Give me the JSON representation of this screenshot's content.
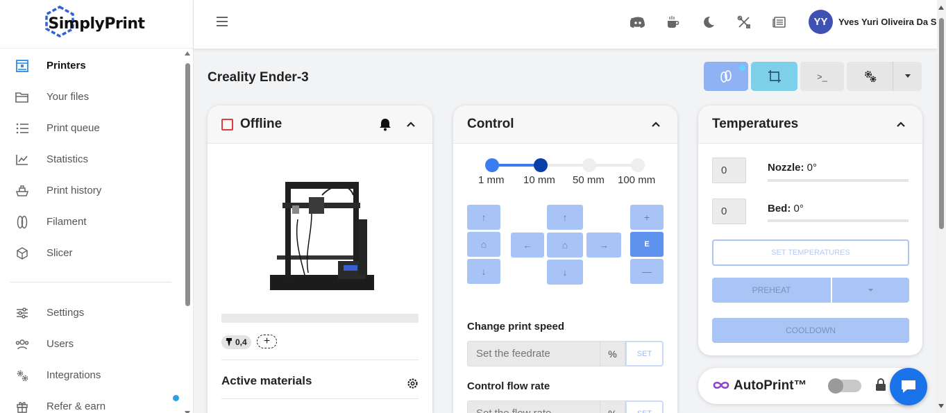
{
  "brand": {
    "logo_text": "SimplyPrint"
  },
  "sidebar": {
    "items": [
      {
        "label": "Printers",
        "icon": "printer-icon",
        "active": true
      },
      {
        "label": "Your files",
        "icon": "folder-icon"
      },
      {
        "label": "Print queue",
        "icon": "list-icon"
      },
      {
        "label": "Statistics",
        "icon": "chart-line-icon"
      },
      {
        "label": "Print history",
        "icon": "history-icon"
      },
      {
        "label": "Filament",
        "icon": "filament-spool-icon"
      },
      {
        "label": "Slicer",
        "icon": "cube-icon"
      }
    ],
    "items_bottom": [
      {
        "label": "Settings",
        "icon": "sliders-icon"
      },
      {
        "label": "Users",
        "icon": "users-icon"
      },
      {
        "label": "Integrations",
        "icon": "gears-icon"
      },
      {
        "label": "Refer & earn",
        "icon": "gift-icon"
      }
    ]
  },
  "topbar": {
    "icons": [
      "discord-icon",
      "coffee-icon",
      "moon-icon",
      "tools-icon",
      "news-icon"
    ],
    "avatar_initials": "YY",
    "username": "Yves Yuri Oliveira Da S"
  },
  "printer": {
    "name": "Creality Ender-3",
    "header_buttons": {
      "terminal_label": ">_"
    }
  },
  "status_card": {
    "title": "Offline",
    "nozzle_size": "0,4",
    "add_label": "+",
    "active_materials_title": "Active materials"
  },
  "control_card": {
    "title": "Control",
    "steps": [
      "1 mm",
      "10 mm",
      "50 mm",
      "100 mm"
    ],
    "selected_step": "10 mm",
    "jog": {
      "plus": "+",
      "minus": "—",
      "extruder": "E",
      "up": "↑",
      "down": "↓",
      "left": "←",
      "right": "→",
      "home": "⌂"
    },
    "print_speed": {
      "title": "Change print speed",
      "placeholder": "Set the feedrate",
      "unit": "%",
      "button": "SET"
    },
    "flow_rate": {
      "title": "Control flow rate",
      "placeholder": "Set the flow rate",
      "unit": "%",
      "button": "SET"
    }
  },
  "temperature_card": {
    "title": "Temperatures",
    "nozzle": {
      "input": "0",
      "label": "Nozzle:",
      "value": "0°"
    },
    "bed": {
      "input": "0",
      "label": "Bed:",
      "value": "0°"
    },
    "set_button": "SET TEMPERATURES",
    "preheat_button": "PREHEAT",
    "cooldown_button": "COOLDOWN"
  },
  "autoprint": {
    "title": "AutoPrint™",
    "enabled": false
  },
  "colors": {
    "accent": "#3b7df0",
    "offline": "#e0393e",
    "avatar": "#3f51b5"
  }
}
